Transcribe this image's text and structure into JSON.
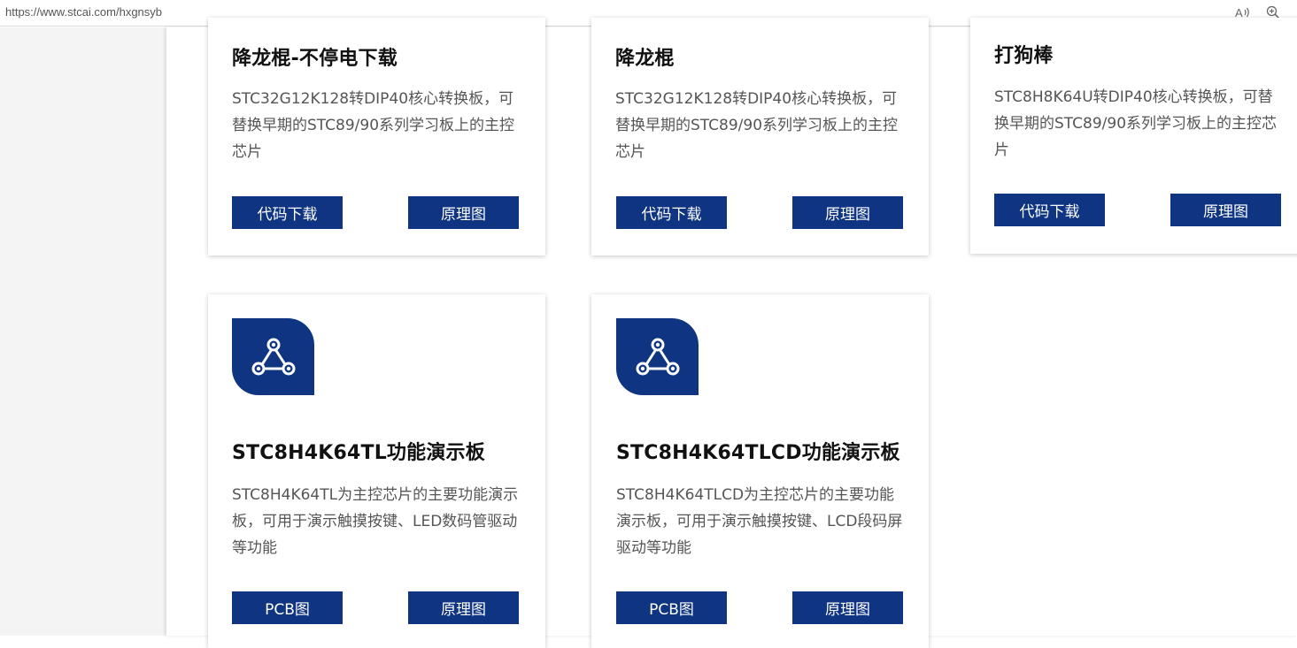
{
  "browser": {
    "url": "https://www.stcai.com/hxgnsyb",
    "read_aloud_icon": "read-aloud-icon",
    "zoom_icon": "zoom-in-icon"
  },
  "colors": {
    "brand_blue": "#0f3481",
    "title_text": "#111111",
    "desc_text": "#555555"
  },
  "cards": [
    {
      "title": "降龙棍-不停电下载",
      "desc": "STC32G12K128转DIP40核心转换板，可替换早期的STC89/90系列学习板上的主控芯片",
      "btn1": "代码下载",
      "btn2": "原理图"
    },
    {
      "title": "降龙棍",
      "desc": "STC32G12K128转DIP40核心转换板，可替换早期的STC89/90系列学习板上的主控芯片",
      "btn1": "代码下载",
      "btn2": "原理图"
    },
    {
      "title": "打狗棒",
      "desc": "STC8H8K64U转DIP40核心转换板，可替换早期的STC89/90系列学习板上的主控芯片",
      "btn1": "代码下载",
      "btn2": "原理图"
    },
    {
      "icon": "share-network-icon",
      "title": "STC8H4K64TL功能演示板",
      "desc": "STC8H4K64TL为主控芯片的主要功能演示板，可用于演示触摸按键、LED数码管驱动等功能",
      "btn1": "PCB图",
      "btn2": "原理图"
    },
    {
      "icon": "share-network-icon",
      "title": "STC8H4K64TLCD功能演示板",
      "desc": "STC8H4K64TLCD为主控芯片的主要功能演示板，可用于演示触摸按键、LCD段码屏驱动等功能",
      "btn1": "PCB图",
      "btn2": "原理图"
    }
  ]
}
